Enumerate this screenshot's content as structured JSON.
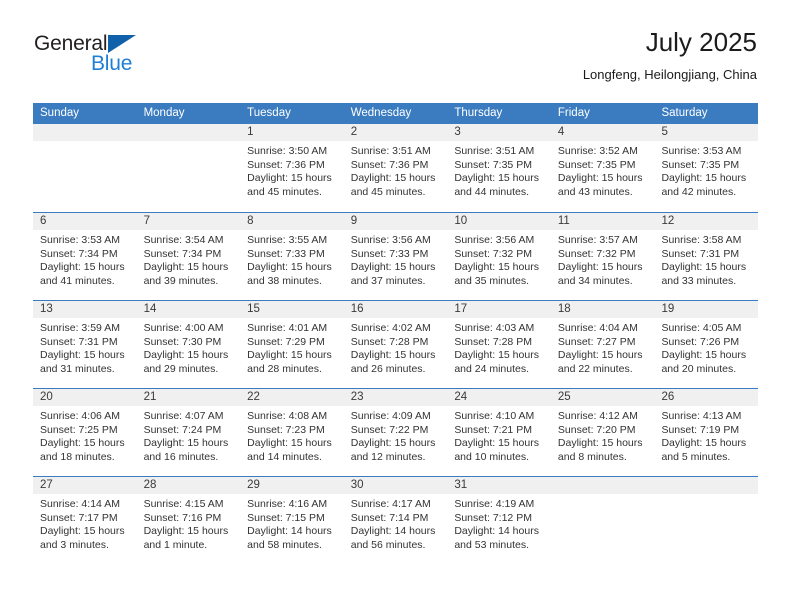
{
  "brand": {
    "name_dark": "General",
    "name_blue": "Blue",
    "color_dark": "#231f20",
    "color_blue": "#1e7fd4",
    "triangle_color": "#1060aa"
  },
  "header": {
    "title": "July 2025",
    "subtitle": "Longfeng, Heilongjiang, China"
  },
  "theme": {
    "header_blue": "#3b7cc0",
    "day_band_gray": "#f0f0f0",
    "text": "#333333"
  },
  "weekdays": [
    "Sunday",
    "Monday",
    "Tuesday",
    "Wednesday",
    "Thursday",
    "Friday",
    "Saturday"
  ],
  "weeks": [
    [
      {
        "day": "",
        "sunrise": "",
        "sunset": "",
        "daylight": ""
      },
      {
        "day": "",
        "sunrise": "",
        "sunset": "",
        "daylight": ""
      },
      {
        "day": "1",
        "sunrise": "Sunrise: 3:50 AM",
        "sunset": "Sunset: 7:36 PM",
        "daylight": "Daylight: 15 hours and 45 minutes."
      },
      {
        "day": "2",
        "sunrise": "Sunrise: 3:51 AM",
        "sunset": "Sunset: 7:36 PM",
        "daylight": "Daylight: 15 hours and 45 minutes."
      },
      {
        "day": "3",
        "sunrise": "Sunrise: 3:51 AM",
        "sunset": "Sunset: 7:35 PM",
        "daylight": "Daylight: 15 hours and 44 minutes."
      },
      {
        "day": "4",
        "sunrise": "Sunrise: 3:52 AM",
        "sunset": "Sunset: 7:35 PM",
        "daylight": "Daylight: 15 hours and 43 minutes."
      },
      {
        "day": "5",
        "sunrise": "Sunrise: 3:53 AM",
        "sunset": "Sunset: 7:35 PM",
        "daylight": "Daylight: 15 hours and 42 minutes."
      }
    ],
    [
      {
        "day": "6",
        "sunrise": "Sunrise: 3:53 AM",
        "sunset": "Sunset: 7:34 PM",
        "daylight": "Daylight: 15 hours and 41 minutes."
      },
      {
        "day": "7",
        "sunrise": "Sunrise: 3:54 AM",
        "sunset": "Sunset: 7:34 PM",
        "daylight": "Daylight: 15 hours and 39 minutes."
      },
      {
        "day": "8",
        "sunrise": "Sunrise: 3:55 AM",
        "sunset": "Sunset: 7:33 PM",
        "daylight": "Daylight: 15 hours and 38 minutes."
      },
      {
        "day": "9",
        "sunrise": "Sunrise: 3:56 AM",
        "sunset": "Sunset: 7:33 PM",
        "daylight": "Daylight: 15 hours and 37 minutes."
      },
      {
        "day": "10",
        "sunrise": "Sunrise: 3:56 AM",
        "sunset": "Sunset: 7:32 PM",
        "daylight": "Daylight: 15 hours and 35 minutes."
      },
      {
        "day": "11",
        "sunrise": "Sunrise: 3:57 AM",
        "sunset": "Sunset: 7:32 PM",
        "daylight": "Daylight: 15 hours and 34 minutes."
      },
      {
        "day": "12",
        "sunrise": "Sunrise: 3:58 AM",
        "sunset": "Sunset: 7:31 PM",
        "daylight": "Daylight: 15 hours and 33 minutes."
      }
    ],
    [
      {
        "day": "13",
        "sunrise": "Sunrise: 3:59 AM",
        "sunset": "Sunset: 7:31 PM",
        "daylight": "Daylight: 15 hours and 31 minutes."
      },
      {
        "day": "14",
        "sunrise": "Sunrise: 4:00 AM",
        "sunset": "Sunset: 7:30 PM",
        "daylight": "Daylight: 15 hours and 29 minutes."
      },
      {
        "day": "15",
        "sunrise": "Sunrise: 4:01 AM",
        "sunset": "Sunset: 7:29 PM",
        "daylight": "Daylight: 15 hours and 28 minutes."
      },
      {
        "day": "16",
        "sunrise": "Sunrise: 4:02 AM",
        "sunset": "Sunset: 7:28 PM",
        "daylight": "Daylight: 15 hours and 26 minutes."
      },
      {
        "day": "17",
        "sunrise": "Sunrise: 4:03 AM",
        "sunset": "Sunset: 7:28 PM",
        "daylight": "Daylight: 15 hours and 24 minutes."
      },
      {
        "day": "18",
        "sunrise": "Sunrise: 4:04 AM",
        "sunset": "Sunset: 7:27 PM",
        "daylight": "Daylight: 15 hours and 22 minutes."
      },
      {
        "day": "19",
        "sunrise": "Sunrise: 4:05 AM",
        "sunset": "Sunset: 7:26 PM",
        "daylight": "Daylight: 15 hours and 20 minutes."
      }
    ],
    [
      {
        "day": "20",
        "sunrise": "Sunrise: 4:06 AM",
        "sunset": "Sunset: 7:25 PM",
        "daylight": "Daylight: 15 hours and 18 minutes."
      },
      {
        "day": "21",
        "sunrise": "Sunrise: 4:07 AM",
        "sunset": "Sunset: 7:24 PM",
        "daylight": "Daylight: 15 hours and 16 minutes."
      },
      {
        "day": "22",
        "sunrise": "Sunrise: 4:08 AM",
        "sunset": "Sunset: 7:23 PM",
        "daylight": "Daylight: 15 hours and 14 minutes."
      },
      {
        "day": "23",
        "sunrise": "Sunrise: 4:09 AM",
        "sunset": "Sunset: 7:22 PM",
        "daylight": "Daylight: 15 hours and 12 minutes."
      },
      {
        "day": "24",
        "sunrise": "Sunrise: 4:10 AM",
        "sunset": "Sunset: 7:21 PM",
        "daylight": "Daylight: 15 hours and 10 minutes."
      },
      {
        "day": "25",
        "sunrise": "Sunrise: 4:12 AM",
        "sunset": "Sunset: 7:20 PM",
        "daylight": "Daylight: 15 hours and 8 minutes."
      },
      {
        "day": "26",
        "sunrise": "Sunrise: 4:13 AM",
        "sunset": "Sunset: 7:19 PM",
        "daylight": "Daylight: 15 hours and 5 minutes."
      }
    ],
    [
      {
        "day": "27",
        "sunrise": "Sunrise: 4:14 AM",
        "sunset": "Sunset: 7:17 PM",
        "daylight": "Daylight: 15 hours and 3 minutes."
      },
      {
        "day": "28",
        "sunrise": "Sunrise: 4:15 AM",
        "sunset": "Sunset: 7:16 PM",
        "daylight": "Daylight: 15 hours and 1 minute."
      },
      {
        "day": "29",
        "sunrise": "Sunrise: 4:16 AM",
        "sunset": "Sunset: 7:15 PM",
        "daylight": "Daylight: 14 hours and 58 minutes."
      },
      {
        "day": "30",
        "sunrise": "Sunrise: 4:17 AM",
        "sunset": "Sunset: 7:14 PM",
        "daylight": "Daylight: 14 hours and 56 minutes."
      },
      {
        "day": "31",
        "sunrise": "Sunrise: 4:19 AM",
        "sunset": "Sunset: 7:12 PM",
        "daylight": "Daylight: 14 hours and 53 minutes."
      },
      {
        "day": "",
        "sunrise": "",
        "sunset": "",
        "daylight": ""
      },
      {
        "day": "",
        "sunrise": "",
        "sunset": "",
        "daylight": ""
      }
    ]
  ]
}
